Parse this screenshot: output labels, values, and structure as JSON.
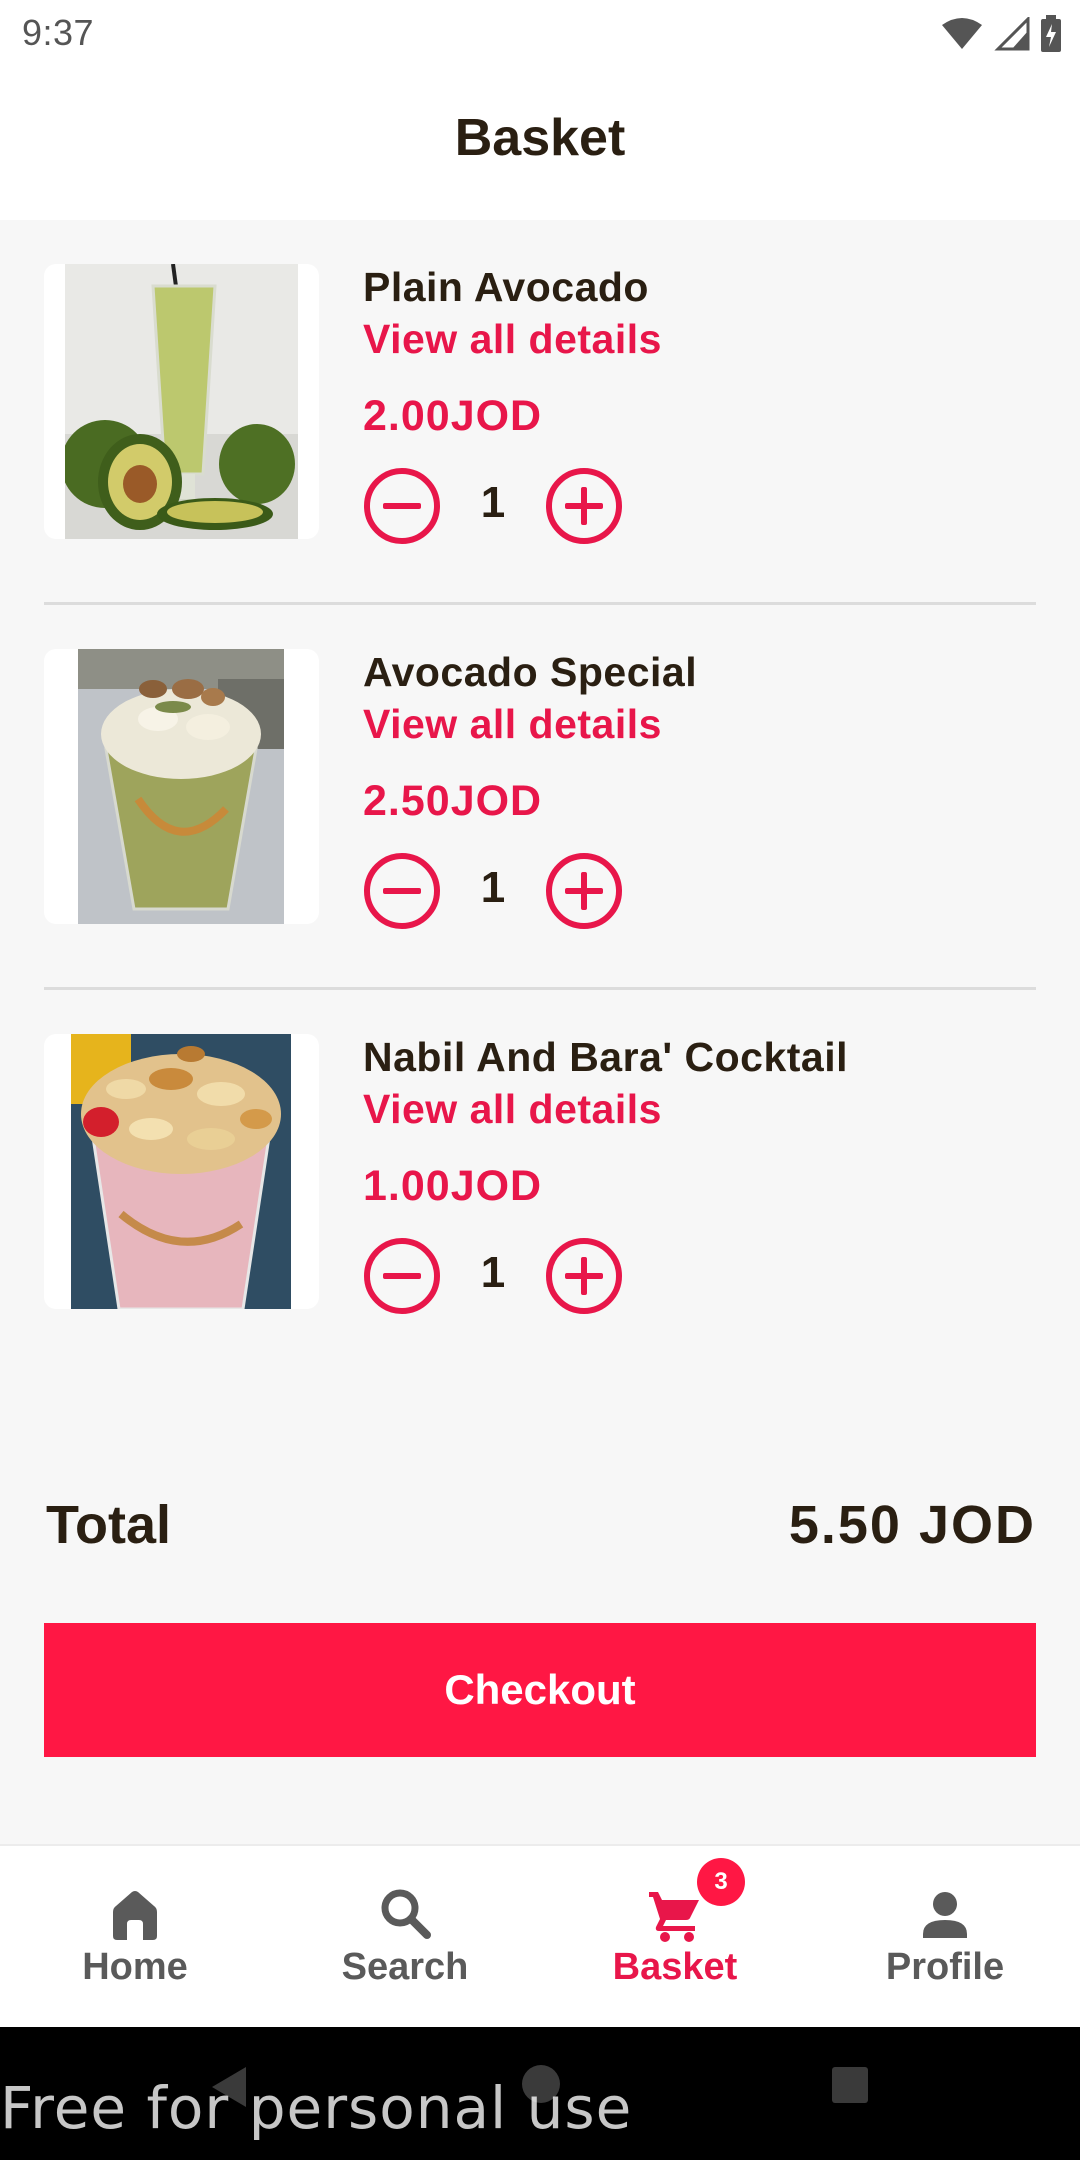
{
  "status_bar": {
    "time": "9:37",
    "icons": [
      "wifi-icon",
      "signal-icon",
      "battery-icon"
    ]
  },
  "header": {
    "title": "Basket"
  },
  "items": [
    {
      "name": "Plain Avocado",
      "details_link": "View all details",
      "price": "2.00JOD",
      "quantity": "1",
      "image": "plain-avocado-drink"
    },
    {
      "name": "Avocado Special",
      "details_link": "View all details",
      "price": "2.50JOD",
      "quantity": "1",
      "image": "avocado-special-cup"
    },
    {
      "name": "Nabil And Bara' Cocktail",
      "details_link": "View all details",
      "price": "1.00JOD",
      "quantity": "1",
      "image": "cocktail-cup"
    }
  ],
  "summary": {
    "total_label": "Total",
    "total_value": "5.50 JOD"
  },
  "checkout": {
    "label": "Checkout"
  },
  "bottom_nav": {
    "items": [
      {
        "label": "Home",
        "icon": "home-icon"
      },
      {
        "label": "Search",
        "icon": "search-icon"
      },
      {
        "label": "Basket",
        "icon": "cart-icon",
        "badge": "3",
        "active": true
      },
      {
        "label": "Profile",
        "icon": "person-icon"
      }
    ]
  },
  "colors": {
    "accent": "#ff1744",
    "text": "#2a1f12",
    "background": "#f7f7f7"
  },
  "watermark": "Free for personal use"
}
